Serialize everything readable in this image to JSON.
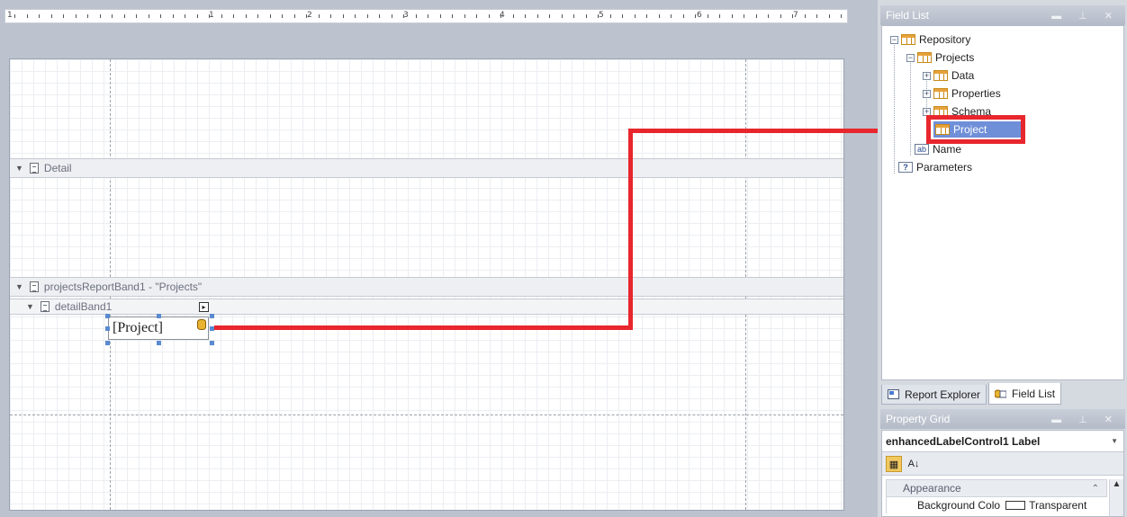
{
  "ruler": {
    "numbers": [
      "1",
      "1",
      "2",
      "3",
      "4",
      "5",
      "6",
      "7"
    ]
  },
  "bands": {
    "detail": "Detail",
    "projects": "projectsReportBand1 - \"Projects\"",
    "detail_sub": "detailBand1"
  },
  "label_control": {
    "text": "[Project]"
  },
  "field_list": {
    "title": "Field List",
    "title_buttons": "▬ ⊥ ✕",
    "nodes": {
      "repository": "Repository",
      "projects": "Projects",
      "data": "Data",
      "properties": "Properties",
      "schema": "Schema",
      "project": "Project",
      "name": "Name",
      "parameters": "Parameters"
    },
    "name_icon": "ab",
    "param_icon": "?"
  },
  "tabs": {
    "report_explorer": "Report Explorer",
    "field_list": "Field List"
  },
  "property_grid": {
    "title": "Property Grid",
    "title_buttons": "▬ ⊥ ✕",
    "selected": "enhancedLabelControl1  Label",
    "category": "Appearance",
    "row_name": "Background Colo",
    "row_value": "Transparent",
    "sort_glyph": "A↓"
  },
  "colors": {
    "highlight": "#e8262d",
    "selection": "#6f8fd8"
  }
}
